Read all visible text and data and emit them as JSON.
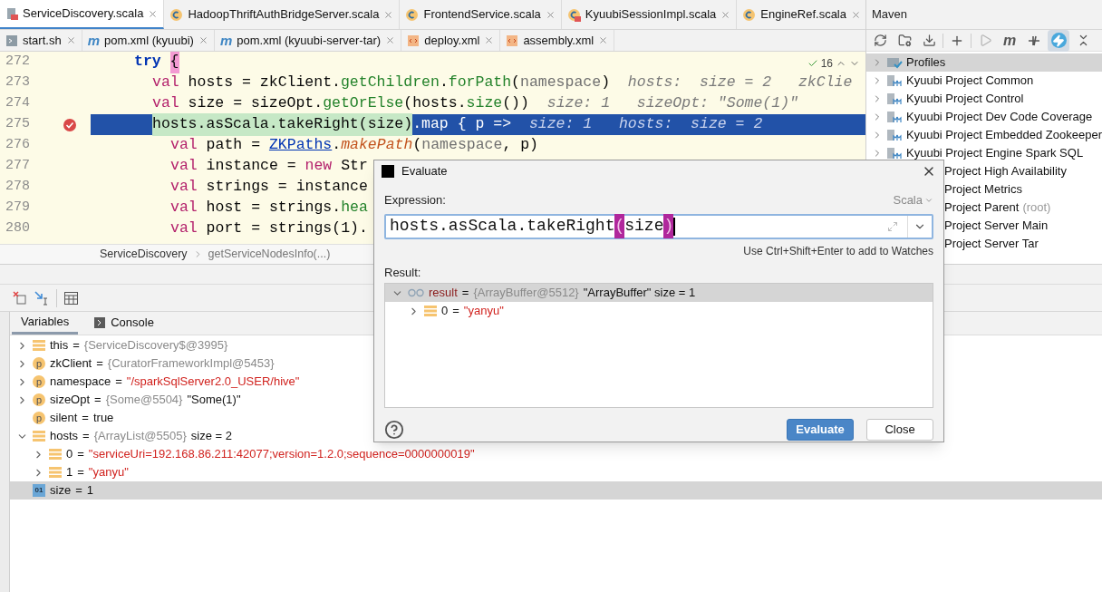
{
  "editor": {
    "tab_rows": [
      {
        "tabs": [
          {
            "label": "ServiceDiscovery.scala",
            "kind": "scala",
            "selected": true
          },
          {
            "label": "HadoopThriftAuthBridgeServer.scala",
            "kind": "class",
            "selected": false
          },
          {
            "label": "FrontendService.scala",
            "kind": "class",
            "selected": false
          },
          {
            "label": "KyuubiSessionImpl.scala",
            "kind": "class-error",
            "selected": false
          },
          {
            "label": "EngineRef.scala",
            "kind": "class",
            "selected": false
          }
        ]
      },
      {
        "tabs": [
          {
            "label": "start.sh",
            "kind": "shell",
            "selected": false
          },
          {
            "label": "pom.xml (kyuubi)",
            "kind": "maven",
            "badge": "m",
            "selected": false
          },
          {
            "label": "pom.xml (kyuubi-server-tar)",
            "kind": "maven",
            "badge": "m",
            "selected": false
          },
          {
            "label": "deploy.xml",
            "kind": "xml",
            "selected": false
          },
          {
            "label": "assembly.xml",
            "kind": "xml",
            "selected": false
          }
        ]
      }
    ],
    "inspection_count": "16",
    "lines": [
      {
        "number": "272",
        "current": false,
        "breakpoint": false,
        "segments": [
          {
            "text": "try ",
            "kind": "keyword"
          },
          {
            "text": "{",
            "kind": "brace_match"
          }
        ],
        "children": [
          {
            "number": "273",
            "current": false,
            "breakpoint": false,
            "segments": [
              {
                "text": "val",
                "kind": "decl"
              },
              {
                "text": " hosts = zkClient.",
                "kind": "ident"
              },
              {
                "text": "getChildren",
                "kind": "method"
              },
              {
                "text": ".",
                "kind": "ident"
              },
              {
                "text": "forPath",
                "kind": "method"
              },
              {
                "text": "(",
                "kind": "ident"
              },
              {
                "text": "namespace",
                "kind": "field"
              },
              {
                "text": ")",
                "kind": "ident"
              },
              {
                "text": "  hosts:  size = 2   zkClie",
                "kind": "hint"
              }
            ]
          },
          {
            "number": "274",
            "current": false,
            "breakpoint": false,
            "segments": [
              {
                "text": "val",
                "kind": "decl"
              },
              {
                "text": " size = sizeOpt.",
                "kind": "ident"
              },
              {
                "text": "getOrElse",
                "kind": "method"
              },
              {
                "text": "(hosts.",
                "kind": "ident"
              },
              {
                "text": "size",
                "kind": "method"
              },
              {
                "text": "())",
                "kind": "ident"
              },
              {
                "text": "  size: 1   sizeOpt: \"Some(1)\"",
                "kind": "hint"
              }
            ]
          },
          {
            "number": "275",
            "current": true,
            "breakpoint": true,
            "segments": [
              {
                "text": "hosts.asScala.takeRight(size)",
                "kind": "eval"
              },
              {
                "text": ".map { p =>",
                "kind": "ident"
              },
              {
                "text": "  size: 1   hosts:  size = 2",
                "kind": "hint"
              }
            ],
            "children": [
              {
                "number": "276",
                "current": false,
                "breakpoint": false,
                "segments": [
                  {
                    "text": "val",
                    "kind": "decl"
                  },
                  {
                    "text": " path = ",
                    "kind": "ident"
                  },
                  {
                    "text": "ZKPaths",
                    "kind": "type"
                  },
                  {
                    "text": ".",
                    "kind": "ident"
                  },
                  {
                    "text": "makePath",
                    "kind": "static_call"
                  },
                  {
                    "text": "(",
                    "kind": "ident"
                  },
                  {
                    "text": "namespace",
                    "kind": "field"
                  },
                  {
                    "text": ", p)",
                    "kind": "ident"
                  }
                ]
              },
              {
                "number": "277",
                "current": false,
                "breakpoint": false,
                "segments": [
                  {
                    "text": "val",
                    "kind": "decl"
                  },
                  {
                    "text": " instance = ",
                    "kind": "ident"
                  },
                  {
                    "text": "new",
                    "kind": "decl"
                  },
                  {
                    "text": " Str",
                    "kind": "ident"
                  }
                ]
              },
              {
                "number": "278",
                "current": false,
                "breakpoint": false,
                "segments": [
                  {
                    "text": "val",
                    "kind": "decl"
                  },
                  {
                    "text": " strings = instance",
                    "kind": "ident"
                  }
                ]
              },
              {
                "number": "279",
                "current": false,
                "breakpoint": false,
                "segments": [
                  {
                    "text": "val",
                    "kind": "decl"
                  },
                  {
                    "text": " host = strings.",
                    "kind": "ident"
                  },
                  {
                    "text": "hea",
                    "kind": "method"
                  }
                ]
              },
              {
                "number": "280",
                "current": false,
                "breakpoint": false,
                "segments": [
                  {
                    "text": "val",
                    "kind": "decl"
                  },
                  {
                    "text": " port = strings(1).",
                    "kind": "ident"
                  }
                ]
              }
            ]
          }
        ]
      }
    ],
    "breadcrumb": [
      "ServiceDiscovery",
      "getServiceNodesInfo(...)"
    ]
  },
  "maven": {
    "title": "Maven",
    "tools": [
      {
        "kind": "refresh",
        "selected": false
      },
      {
        "kind": "folder",
        "selected": false
      },
      {
        "kind": "download",
        "selected": false
      },
      {
        "kind": "add",
        "selected": false
      },
      {
        "kind": "run",
        "selected": false
      },
      {
        "kind": "m",
        "label": "m",
        "selected": false
      },
      {
        "kind": "skip",
        "selected": false
      },
      {
        "kind": "offline",
        "selected": true
      },
      {
        "kind": "collapse",
        "selected": false
      }
    ],
    "items": [
      {
        "kind": "profiles",
        "label": "Profiles",
        "selected": true
      },
      {
        "kind": "module",
        "label": "Kyuubi Project Common",
        "selected": false
      },
      {
        "kind": "module",
        "label": "Kyuubi Project Control",
        "selected": false
      },
      {
        "kind": "module",
        "label": "Kyuubi Project Dev Code Coverage",
        "selected": false
      },
      {
        "kind": "module",
        "label": "Kyuubi Project Embedded Zookeeper",
        "selected": false
      },
      {
        "kind": "module",
        "label": "Kyuubi Project Engine Spark SQL",
        "selected": false
      },
      {
        "kind": "covered",
        "label": "Project High Availability",
        "selected": false
      },
      {
        "kind": "covered",
        "label": "Project Metrics",
        "selected": false
      },
      {
        "kind": "covered",
        "label": "Project Parent",
        "note": "(root)",
        "selected": false
      },
      {
        "kind": "covered",
        "label": "Project Server Main",
        "selected": false
      },
      {
        "kind": "covered",
        "label": "Project Server Tar",
        "selected": false
      }
    ]
  },
  "debugger": {
    "tabs": [
      {
        "label": "Variables",
        "kind": "variables",
        "selected": true
      },
      {
        "label": "Console",
        "kind": "console",
        "selected": false
      }
    ],
    "variables": [
      {
        "kind": "field",
        "name": "this",
        "expanded": false,
        "selected": false,
        "value": [
          {
            "text": "=",
            "kind": "op"
          },
          {
            "text": "{ServiceDiscovery$@3995}",
            "kind": "ref"
          }
        ]
      },
      {
        "kind": "param",
        "badge": "p",
        "name": "zkClient",
        "expanded": false,
        "selected": false,
        "value": [
          {
            "text": "=",
            "kind": "op"
          },
          {
            "text": "{CuratorFrameworkImpl@5453}",
            "kind": "ref"
          }
        ]
      },
      {
        "kind": "param",
        "badge": "p",
        "name": "namespace",
        "expanded": false,
        "selected": false,
        "value": [
          {
            "text": "=",
            "kind": "op"
          },
          {
            "text": "\"/sparkSqlServer2.0_USER/hive\"",
            "kind": "string"
          }
        ]
      },
      {
        "kind": "param",
        "badge": "p",
        "name": "sizeOpt",
        "expanded": false,
        "selected": false,
        "value": [
          {
            "text": "=",
            "kind": "op"
          },
          {
            "text": "{Some@5504}",
            "kind": "ref"
          },
          {
            "text": "\"Some(1)\"",
            "kind": "plain"
          }
        ]
      },
      {
        "kind": "param",
        "badge": "p",
        "name": "silent",
        "selected": false,
        "value": [
          {
            "text": "=",
            "kind": "op"
          },
          {
            "text": "true",
            "kind": "plain"
          }
        ]
      },
      {
        "kind": "field",
        "name": "hosts",
        "expanded": true,
        "selected": false,
        "value": [
          {
            "text": "=",
            "kind": "op"
          },
          {
            "text": "{ArrayList@5505}",
            "kind": "ref"
          },
          {
            "text": " size = 2",
            "kind": "plain"
          }
        ],
        "children": [
          {
            "kind": "field",
            "name": "0",
            "expanded": false,
            "selected": false,
            "value": [
              {
                "text": "=",
                "kind": "op"
              },
              {
                "text": "\"serviceUri=192.168.86.211:42077;version=1.2.0;sequence=0000000019\"",
                "kind": "string"
              }
            ]
          },
          {
            "kind": "field",
            "name": "1",
            "expanded": false,
            "selected": false,
            "value": [
              {
                "text": "=",
                "kind": "op"
              },
              {
                "text": "\"yanyu\"",
                "kind": "string"
              }
            ]
          }
        ]
      },
      {
        "kind": "primitive",
        "badge": "01",
        "name": "size",
        "selected": true,
        "value": [
          {
            "text": "=",
            "kind": "op"
          },
          {
            "text": "1",
            "kind": "plain"
          }
        ]
      }
    ]
  },
  "dialog": {
    "title": "Evaluate",
    "expression_label": "Expression:",
    "language": "Scala",
    "expression": [
      {
        "text": "hosts.asScala.takeRight",
        "kind": "plain"
      },
      {
        "text": "(",
        "kind": "brace"
      },
      {
        "text": "size",
        "kind": "plain"
      },
      {
        "text": ")",
        "kind": "brace"
      }
    ],
    "watch_hint": "Use Ctrl+Shift+Enter to add to Watches",
    "result_label": "Result:",
    "result": [
      {
        "kind": "watch",
        "name": "result",
        "expanded": true,
        "selected": true,
        "value": [
          {
            "text": "=",
            "kind": "op"
          },
          {
            "text": "{ArrayBuffer@5512}",
            "kind": "ref"
          },
          {
            "text": "\"ArrayBuffer\" size = 1",
            "kind": "plain"
          }
        ],
        "children": [
          {
            "kind": "field",
            "name": "0",
            "expanded": false,
            "selected": false,
            "value": [
              {
                "text": "=",
                "kind": "op"
              },
              {
                "text": "\"yanyu\"",
                "kind": "string"
              }
            ]
          }
        ]
      }
    ],
    "buttons": [
      {
        "label": "Evaluate",
        "kind": "primary"
      },
      {
        "label": "Close",
        "kind": "secondary"
      }
    ]
  }
}
